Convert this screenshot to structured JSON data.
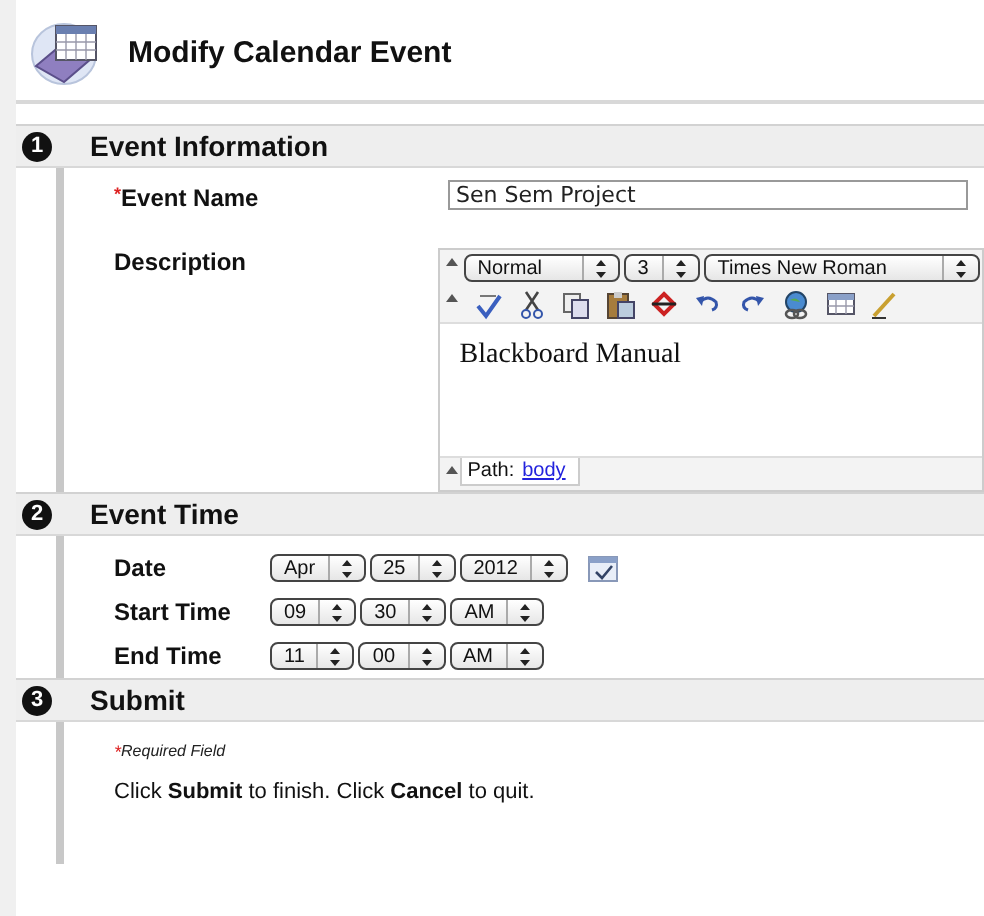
{
  "page": {
    "title": "Modify Calendar Event"
  },
  "sections": [
    {
      "kind": "info",
      "number": "1",
      "title": "Event Information",
      "event_name": {
        "required_mark": "*",
        "label": "Event Name",
        "value": "Sen Sem Project"
      },
      "description": {
        "label": "Description",
        "editor": {
          "format": "Normal",
          "size": "3",
          "font": "Times New Roman",
          "text": "Blackboard Manual",
          "path_label": "Path:",
          "path": "body"
        }
      }
    },
    {
      "kind": "time",
      "number": "2",
      "title": "Event Time",
      "rows": [
        {
          "label": "Date",
          "selects": [
            "Apr",
            "25",
            "2012"
          ],
          "calendar": true
        },
        {
          "label": "Start Time",
          "selects": [
            "09",
            "30",
            "AM"
          ]
        },
        {
          "label": "End Time",
          "selects": [
            "11",
            "00",
            "AM"
          ]
        }
      ]
    },
    {
      "kind": "submit",
      "number": "3",
      "title": "Submit",
      "required_mark": "*",
      "required_note": "Required Field",
      "instructions": "Click **Submit** to finish. Click **Cancel** to quit."
    }
  ]
}
